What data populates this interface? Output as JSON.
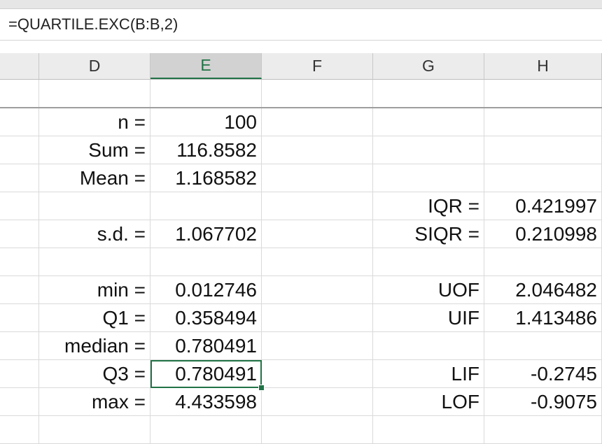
{
  "formula_bar": {
    "formula": "=QUARTILE.EXC(B:B,2)"
  },
  "columns": [
    "",
    "D",
    "E",
    "F",
    "G",
    "H"
  ],
  "selected_column": "E",
  "rows": [
    {
      "D": "",
      "E": "",
      "F": "",
      "G": "",
      "H": ""
    },
    {
      "D": "n =",
      "E": "100",
      "F": "",
      "G": "",
      "H": ""
    },
    {
      "D": "Sum =",
      "E": "116.8582",
      "F": "",
      "G": "",
      "H": ""
    },
    {
      "D": "Mean =",
      "E": "1.168582",
      "F": "",
      "G": "",
      "H": ""
    },
    {
      "D": "",
      "E": "",
      "F": "",
      "G": "IQR =",
      "H": "0.421997"
    },
    {
      "D": "s.d. =",
      "E": "1.067702",
      "F": "",
      "G": "SIQR =",
      "H": "0.210998"
    },
    {
      "D": "",
      "E": "",
      "F": "",
      "G": "",
      "H": ""
    },
    {
      "D": "min =",
      "E": "0.012746",
      "F": "",
      "G": "UOF",
      "H": "2.046482"
    },
    {
      "D": "Q1 =",
      "E": "0.358494",
      "F": "",
      "G": "UIF",
      "H": "1.413486"
    },
    {
      "D": "median =",
      "E": "0.780491",
      "F": "",
      "G": "",
      "H": ""
    },
    {
      "D": "Q3 =",
      "E": "0.780491",
      "F": "",
      "G": "LIF",
      "H": "-0.2745"
    },
    {
      "D": "max =",
      "E": "4.433598",
      "F": "",
      "G": "LOF",
      "H": "-0.9075"
    },
    {
      "D": "",
      "E": "",
      "F": "",
      "G": "",
      "H": ""
    }
  ],
  "active_cell": {
    "row": 10,
    "col": "E"
  },
  "colors": {
    "accent": "#217346",
    "header_bg": "#ececec",
    "gridline": "#dadada"
  }
}
